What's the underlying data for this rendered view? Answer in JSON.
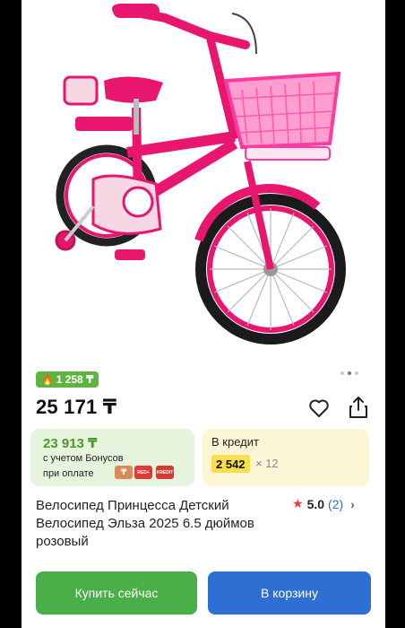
{
  "colors": {
    "bonus_green": "#4b9a2c",
    "buy_button": "#4aae49",
    "cart_button": "#2e6fd3",
    "credit_highlight": "#f7de4a",
    "rating_star": "#e23b3b",
    "product_pink": "#e8166f"
  },
  "gallery": {
    "image_count": 3,
    "active_index": 1
  },
  "bonus_badge": {
    "icon": "flame-icon",
    "value": "1 258 ₸"
  },
  "price": "25 171 ₸",
  "actions": {
    "favorite_icon": "heart-icon",
    "share_icon": "share-icon"
  },
  "bonus_card": {
    "price": "23 913 ₸",
    "line1": "с учетом Бонусов",
    "line2": "при оплате",
    "payment_icons": [
      {
        "name": "kaspi-icon",
        "label": "₸"
      },
      {
        "name": "red-icon",
        "label": "RED+"
      },
      {
        "name": "kredit-icon",
        "label": "KREDIT"
      }
    ]
  },
  "credit_card": {
    "label": "В кредит",
    "amount": "2 542",
    "months": "× 12"
  },
  "product": {
    "title": "Велосипед Принцесса Детский Велосипед Эльза 2025 6.5 дюймов розовый",
    "rating": "5.0",
    "reviews": "(2)"
  },
  "buttons": {
    "buy_now": "Купить сейчас",
    "add_to_cart": "В корзину"
  }
}
